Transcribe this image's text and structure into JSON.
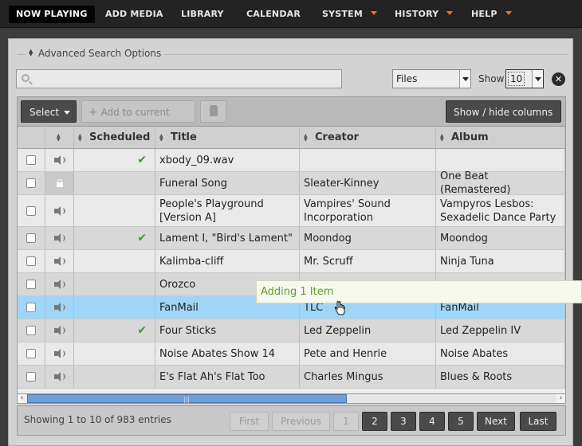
{
  "nav": {
    "items": [
      {
        "label": "NOW PLAYING",
        "has_menu": false
      },
      {
        "label": "ADD MEDIA",
        "has_menu": false
      },
      {
        "label": "LIBRARY",
        "has_menu": false
      },
      {
        "label": "CALENDAR",
        "has_menu": false
      },
      {
        "label": "SYSTEM",
        "has_menu": true
      },
      {
        "label": "HISTORY",
        "has_menu": true
      },
      {
        "label": "HELP",
        "has_menu": true
      }
    ],
    "accent_color": "#ff6b1a"
  },
  "search": {
    "advanced_label": "Advanced Search Options",
    "value": "",
    "placeholder": "",
    "type_select": "Files",
    "show_label": "Show",
    "show_select": "10"
  },
  "toolbar": {
    "select_label": "Select",
    "add_label": "Add to current show",
    "show_hide_label": "Show / hide columns"
  },
  "table": {
    "columns": [
      "Scheduled",
      "Title",
      "Creator",
      "Album"
    ],
    "rows": [
      {
        "icon": "speaker-icon",
        "scheduled": true,
        "title": "xbody_09.wav",
        "creator": "",
        "album": ""
      },
      {
        "icon": "lock-icon",
        "scheduled": false,
        "title": "Funeral Song",
        "creator": "Sleater-Kinney",
        "album": "One Beat (Remastered)"
      },
      {
        "icon": "speaker-icon",
        "scheduled": false,
        "title": "People's Playground [Version A]",
        "creator": "Vampires' Sound Incorporation",
        "album": "Vampyros Lesbos: Sexadelic Dance Party"
      },
      {
        "icon": "speaker-icon",
        "scheduled": true,
        "title": "Lament I, \"Bird's Lament\"",
        "creator": "Moondog",
        "album": "Moondog"
      },
      {
        "icon": "speaker-icon",
        "scheduled": false,
        "title": "Kalimba-cliff",
        "creator": "Mr. Scruff",
        "album": "Ninja Tuna"
      },
      {
        "icon": "speaker-icon",
        "scheduled": false,
        "title": "Orozco",
        "creator": "",
        "album": ""
      },
      {
        "icon": "speaker-icon",
        "scheduled": false,
        "title": "FanMail",
        "creator": "TLC",
        "album": "FanMail",
        "selected": true
      },
      {
        "icon": "speaker-icon",
        "scheduled": true,
        "title": "Four Sticks",
        "creator": "Led Zeppelin",
        "album": "Led Zeppelin IV"
      },
      {
        "icon": "speaker-icon",
        "scheduled": false,
        "title": "Noise Abates Show 14",
        "creator": "Pete and Henrie",
        "album": "Noise Abates"
      },
      {
        "icon": "speaker-icon",
        "scheduled": false,
        "title": "E's Flat Ah's Flat Too",
        "creator": "Charles Mingus",
        "album": "Blues & Roots"
      }
    ],
    "drag_tooltip": "Adding 1 Item",
    "selected_color": "#9fd6f8"
  },
  "footer": {
    "info": "Showing 1 to 10 of 983 entries",
    "first": "First",
    "previous": "Previous",
    "pages": [
      "1",
      "2",
      "3",
      "4",
      "5"
    ],
    "current_page": "1",
    "next": "Next",
    "last": "Last"
  }
}
